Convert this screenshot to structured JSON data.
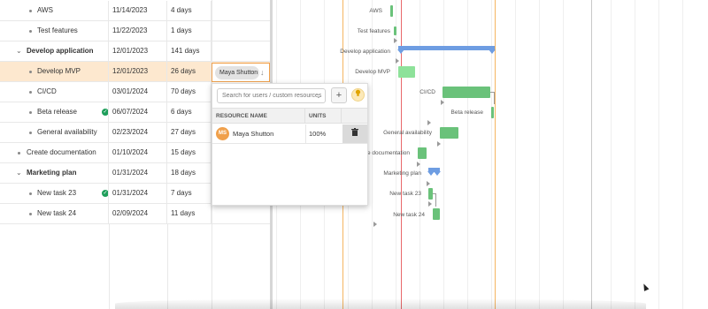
{
  "grid": {
    "rows": [
      {
        "name": "AWS",
        "start": "11/14/2023",
        "duration": "4 days"
      },
      {
        "name": "Test features",
        "start": "11/22/2023",
        "duration": "1 days"
      },
      {
        "name": "Develop application",
        "start": "12/01/2023",
        "duration": "141 days"
      },
      {
        "name": "Develop MVP",
        "start": "12/01/2023",
        "duration": "26 days"
      },
      {
        "name": "CI/CD",
        "start": "03/01/2024",
        "duration": "70 days"
      },
      {
        "name": "Beta release",
        "start": "06/07/2024",
        "duration": "6 days"
      },
      {
        "name": "General availability",
        "start": "02/23/2024",
        "duration": "27 days"
      },
      {
        "name": "Create documentation",
        "start": "01/10/2024",
        "duration": "15 days"
      },
      {
        "name": "Marketing plan",
        "start": "01/31/2024",
        "duration": "18 days"
      },
      {
        "name": "New task 23",
        "start": "01/31/2024",
        "duration": "7 days"
      },
      {
        "name": "New task 24",
        "start": "02/09/2024",
        "duration": "11 days"
      }
    ],
    "selected_resource": "Maya Shutton",
    "collapse_glyph": "⌄",
    "completed_glyph": "✓"
  },
  "resource_popup": {
    "search_placeholder": "Search for users / custom resources",
    "add_label": "+",
    "bulb_icon": "lightbulb-icon",
    "columns": {
      "name": "RESOURCE NAME",
      "units": "UNITS"
    },
    "rows": [
      {
        "initials": "MS",
        "name": "Maya Shutton",
        "units": "100%"
      }
    ],
    "trash_icon": "trash-icon"
  },
  "gantt": {
    "labels": {
      "aws": "AWS",
      "test_features": "Test features",
      "develop_application": "Develop application",
      "develop_mvp": "Develop MVP",
      "cicd": "CI/CD",
      "beta_release": "Beta release",
      "general_availability": "General availability",
      "create_documentation": "e documentation",
      "marketing_plan": "Marketing plan",
      "new_task_23": "New task 23",
      "new_task_24": "New task 24"
    }
  },
  "colors": {
    "task_bar": "#6ac27a",
    "summary_bar": "#6e9de2",
    "selected_row": "#fde8cf",
    "today_line": "#e8696b",
    "marker_line": "#f5b561"
  }
}
